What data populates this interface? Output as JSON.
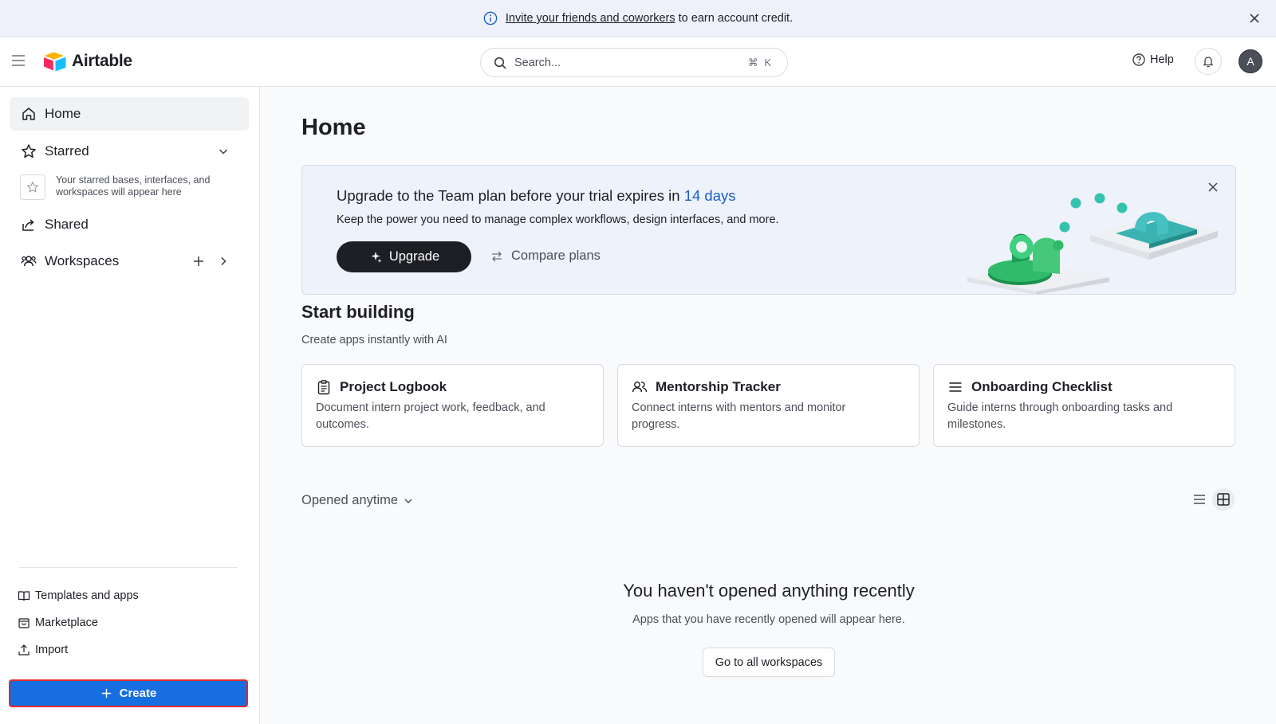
{
  "banner": {
    "link_text": "Invite your friends and coworkers",
    "rest_text": "to earn account credit."
  },
  "topbar": {
    "app_name": "Airtable",
    "search_placeholder": "Search...",
    "search_shortcut": "⌘ K",
    "help_label": "Help",
    "avatar_initial": "A"
  },
  "sidebar": {
    "home": "Home",
    "starred": "Starred",
    "starred_empty": "Your starred bases, interfaces, and workspaces will appear here",
    "shared": "Shared",
    "workspaces": "Workspaces",
    "templates": "Templates and apps",
    "marketplace": "Marketplace",
    "import": "Import",
    "create": "Create"
  },
  "main": {
    "title": "Home",
    "upgrade": {
      "title_prefix": "Upgrade to the Team plan before your trial expires in",
      "days": "14 days",
      "description": "Keep the power you need to manage complex workflows, design interfaces, and more.",
      "upgrade_label": "Upgrade",
      "compare_label": "Compare plans"
    },
    "start_building": {
      "title": "Start building",
      "subtitle": "Create apps instantly with AI",
      "cards": [
        {
          "title": "Project Logbook",
          "body": "Document intern project work, feedback, and outcomes."
        },
        {
          "title": "Mentorship Tracker",
          "body": "Connect interns with mentors and monitor progress."
        },
        {
          "title": "Onboarding Checklist",
          "body": "Guide interns through onboarding tasks and milestones."
        }
      ]
    },
    "filter_label": "Opened anytime",
    "empty": {
      "title": "You haven't opened anything recently",
      "subtitle": "Apps that you have recently opened will appear here.",
      "button": "Go to all workspaces"
    }
  },
  "colors": {
    "accent_blue": "#166ee1",
    "days_blue": "#1b5fc1",
    "highlight_red": "#e22b2b"
  }
}
